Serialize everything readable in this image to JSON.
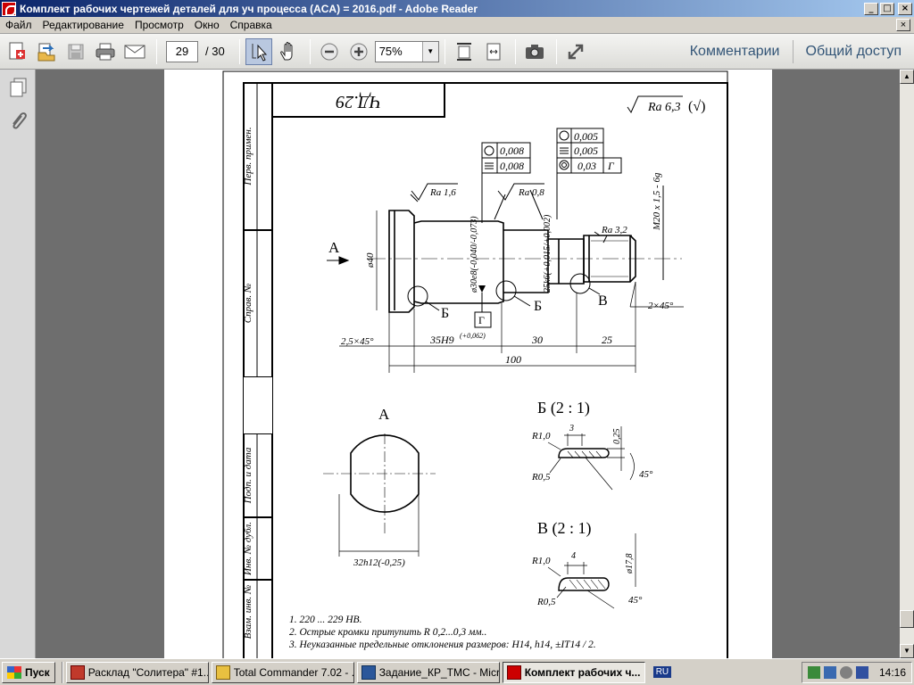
{
  "window": {
    "title": "Комплект рабочих чертежей деталей для уч процесса (ACA) = 2016.pdf - Adobe Reader",
    "min": "_",
    "max": "□",
    "close": "×"
  },
  "menu": [
    "Файл",
    "Редактирование",
    "Просмотр",
    "Окно",
    "Справка"
  ],
  "toolbar": {
    "page_current": "29",
    "page_total": "/ 30",
    "zoom": "75%",
    "comments": "Комментарии",
    "share": "Общий доступ"
  },
  "drawing": {
    "title_box": "ЧД.29",
    "roughness_general": "Ra 6,3",
    "roughness_paren": "(√)",
    "tol_left": [
      {
        "sym": "○",
        "val": "0,008"
      },
      {
        "sym": "=",
        "val": "0,008"
      }
    ],
    "tol_right": [
      {
        "sym": "○",
        "val": "0,005"
      },
      {
        "sym": "=",
        "val": "0,005"
      },
      {
        "sym": "◎",
        "val": "0,03",
        "datum": "Г"
      }
    ],
    "ra_labels": [
      "Ra 1,6",
      "Ra 0,8",
      "Ra 3,2"
    ],
    "thread": "M20 x 1,5 - 6g",
    "view_a_arrow": "A",
    "dia_40": "ø40",
    "dia_30": "ø30e8(-0,040/-0,073)",
    "dia_25": "25k6(+0,015/+0,002)",
    "chamfer_2": "2×45°",
    "chamfer_25": "2,5×45°",
    "dim_35": "35H9",
    "dim_35_tol": "(+0,062)",
    "dim_30": "30",
    "dim_25": "25",
    "dim_100": "100",
    "label_b1": "Б",
    "label_b2": "Б",
    "label_v": "В",
    "datum_g": "Г",
    "section_a": "A",
    "dim_32": "32h12(-0,25)",
    "detail_b": "Б (2 : 1)",
    "detail_v": "В (2 : 1)",
    "r1": "R1,0",
    "r05": "R0,5",
    "d3": "3",
    "d025": "0,25",
    "a45": "45°",
    "r1b": "R1,0",
    "r05b": "R0,5",
    "d4": "4",
    "d178": "ø17,8",
    "a45b": "45°",
    "side_labels": [
      "Перв. примен.",
      "Справ. №",
      "Подп. и дата",
      "Инв. № дубл.",
      "Взам. инв. №"
    ],
    "notes": [
      "1. 220 ... 229 HB.",
      "2. Острые кромки притупить R 0,2...0,3 мм..",
      "3. Неуказанные предельные отклонения размеров: H14, h14, ±IT14 / 2."
    ]
  },
  "taskbar": {
    "start": "Пуск",
    "tasks": [
      "Расклад \"Солитера\" #1...",
      "Total Commander 7.02 - ...",
      "Задание_КР_ТМС - Micr...",
      "Комплект рабочих ч..."
    ],
    "lang": "RU",
    "clock": "14:16"
  }
}
